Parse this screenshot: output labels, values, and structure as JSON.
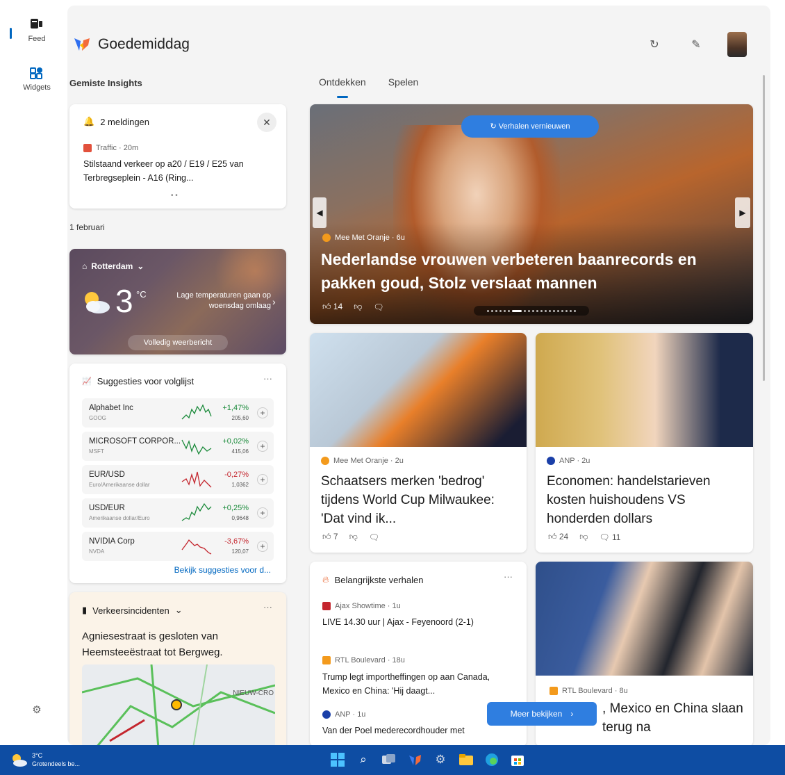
{
  "rail": {
    "feed_label": "Feed",
    "widgets_label": "Widgets"
  },
  "header": {
    "greeting": "Goedemiddag"
  },
  "left": {
    "insights_label": "Gemiste Insights",
    "notifications": {
      "title": "2 meldingen",
      "source": "Traffic · 20m",
      "text": "Stilstaand verkeer op a20 / E19 / E25 van Terbregseplein - A16 (Ring...",
      "pager": "• •"
    },
    "date_label": "1 februari",
    "weather": {
      "city": "Rotterdam",
      "temp": "3",
      "unit": "°C",
      "forecast": "Lage temperaturen gaan op woensdag omlaag",
      "button": "Volledig weerbericht"
    },
    "watchlist": {
      "title": "Suggesties voor volglijst",
      "more": "···",
      "stocks": [
        {
          "name": "Alphabet Inc",
          "ticker": "GOOG",
          "change": "+1,47%",
          "value": "205,60",
          "up": true
        },
        {
          "name": "MICROSOFT CORPOR...",
          "ticker": "MSFT",
          "change": "+0,02%",
          "value": "415,06",
          "up": true
        },
        {
          "name": "EUR/USD",
          "ticker": "Euro/Amerikaanse dollar",
          "change": "-0,27%",
          "value": "1,0362",
          "up": false
        },
        {
          "name": "USD/EUR",
          "ticker": "Amerikaanse dollar/Euro",
          "change": "+0,25%",
          "value": "0,9648",
          "up": true
        },
        {
          "name": "NVIDIA Corp",
          "ticker": "NVDA",
          "change": "-3,67%",
          "value": "120,07",
          "up": false
        }
      ],
      "link": "Bekijk suggesties voor d..."
    },
    "traffic": {
      "title": "Verkeersincidenten",
      "more": "···",
      "text": "Agniesestraat is gesloten van Heemsteeëstraat tot Bergweg.",
      "map_label": "NIEUW-CRO"
    }
  },
  "main": {
    "tabs": [
      "Ontdekken",
      "Spelen"
    ],
    "hero": {
      "refresh": "Verhalen vernieuwen",
      "source": "Mee Met Oranje · 6u",
      "title": "Nederlandse vrouwen verbeteren baanrecords en pakken goud, Stolz verslaat mannen",
      "likes": "14"
    },
    "card1": {
      "source": "Mee Met Oranje · 2u",
      "title": "Schaatsers merken 'bedrog' tijdens World Cup Milwaukee: 'Dat vind ik...",
      "likes": "7"
    },
    "card2": {
      "source": "ANP · 2u",
      "title": "Economen: handelstarieven kosten huishoudens VS honderden dollars",
      "likes": "24",
      "comments": "11"
    },
    "top_stories": {
      "title": "Belangrijkste verhalen",
      "more": "···",
      "items": [
        {
          "source": "Ajax Showtime · 1u",
          "text": "LIVE 14.30 uur | Ajax - Feyenoord (2-1)"
        },
        {
          "source": "RTL Boulevard · 18u",
          "text": "Trump legt importheffingen op aan Canada, Mexico en China: 'Hij daagt..."
        },
        {
          "source": "ANP · 1u",
          "text": "Van der Poel mederecordhouder met"
        }
      ]
    },
    "card3": {
      "source": "RTL Boulevard · 8u",
      "title": ", Mexico en China slaan terug na"
    },
    "more_button": "Meer bekijken"
  },
  "taskbar": {
    "temp": "3°C",
    "condition": "Grotendeels be..."
  },
  "colors": {
    "accent": "#0067c0",
    "up": "#1a8a3a",
    "down": "#c4262e",
    "taskbar": "#0e4da3"
  }
}
